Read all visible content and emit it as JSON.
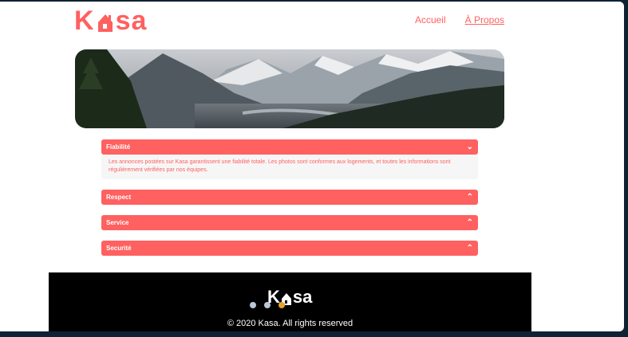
{
  "brand": {
    "name_left": "K",
    "name_right": "sa",
    "color": "#ff6060"
  },
  "nav": {
    "home": "Accueil",
    "about": "À Propos"
  },
  "collapses": [
    {
      "title": "Fiabilité",
      "expanded": true,
      "icon": "chevron-down-icon",
      "content": "Les annonces postées sur Kasa garantissent une fiabilité totale. Les photos sont conformes aux logements, et toutes les informations sont régulièrement vérifiées par nos équipes."
    },
    {
      "title": "Respect",
      "expanded": false,
      "icon": "chevron-up-icon"
    },
    {
      "title": "Service",
      "expanded": false,
      "icon": "chevron-up-icon"
    },
    {
      "title": "Securité",
      "expanded": false,
      "icon": "chevron-up-icon"
    }
  ],
  "footer": {
    "logo_left": "K",
    "logo_right": "sa",
    "copyright": "© 2020 Kasa. All rights reserved",
    "dot_colors": [
      "#b8c8d8",
      "#b8c8d8",
      "#e8a030"
    ]
  }
}
